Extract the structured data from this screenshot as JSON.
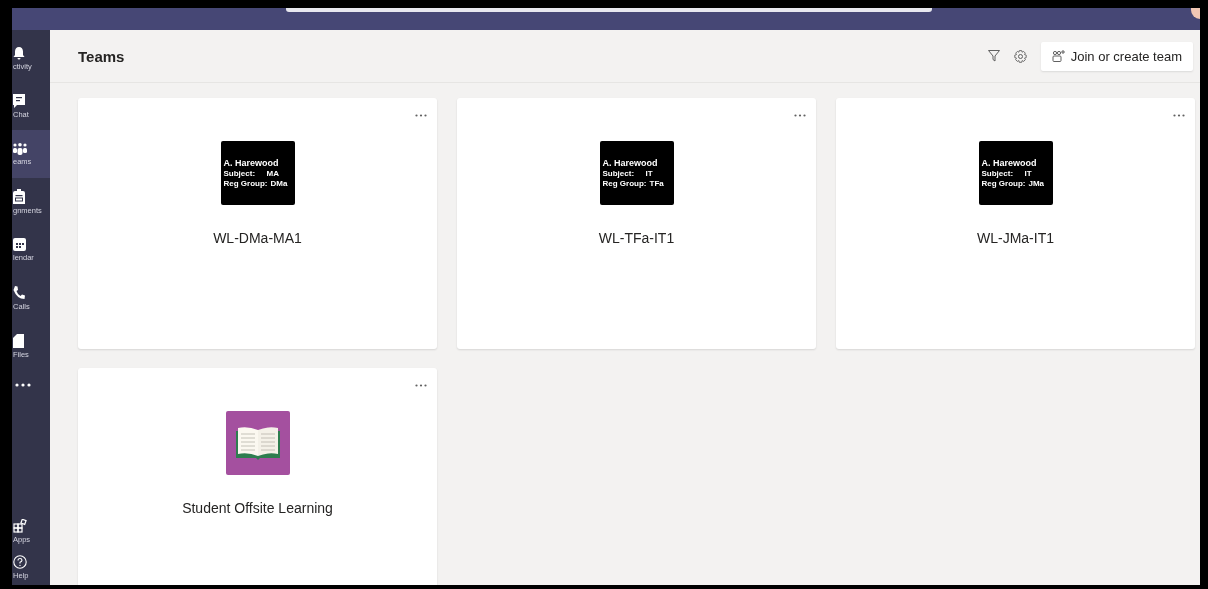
{
  "rail": {
    "items": [
      {
        "kind": "bell",
        "label": "ctivity",
        "selected": false
      },
      {
        "kind": "chat",
        "label": "Chat",
        "selected": false
      },
      {
        "kind": "teams",
        "label": "eams",
        "selected": true
      },
      {
        "kind": "bag",
        "label": "gnments",
        "selected": false
      },
      {
        "kind": "calendar",
        "label": "lendar",
        "selected": false
      },
      {
        "kind": "phone",
        "label": "Calls",
        "selected": false
      },
      {
        "kind": "file",
        "label": "Files",
        "selected": false
      },
      {
        "kind": "more",
        "selected": false
      }
    ],
    "bottom_items": [
      {
        "kind": "apps",
        "label": "Apps",
        "selected": false
      },
      {
        "kind": "help",
        "label": "Help",
        "selected": false
      }
    ]
  },
  "header": {
    "title": "Teams",
    "join_button": "Join or create team"
  },
  "teams": [
    {
      "name": "WL-DMa-MA1",
      "avatar": {
        "kind": "text-tile",
        "owner": "A. Harewood",
        "rows": [
          {
            "label": "Subject:",
            "value": "MA"
          },
          {
            "label": "Reg Group:",
            "value": "DMa"
          }
        ]
      }
    },
    {
      "name": "WL-TFa-IT1",
      "avatar": {
        "kind": "text-tile",
        "owner": "A. Harewood",
        "rows": [
          {
            "label": "Subject:",
            "value": "IT"
          },
          {
            "label": "Reg Group:",
            "value": "TFa"
          }
        ]
      }
    },
    {
      "name": "WL-JMa-IT1",
      "avatar": {
        "kind": "text-tile",
        "owner": "A. Harewood",
        "rows": [
          {
            "label": "Subject:",
            "value": "IT"
          },
          {
            "label": "Reg Group:",
            "value": "JMa"
          }
        ]
      }
    },
    {
      "name": "Student Offsite Learning",
      "avatar": {
        "kind": "book"
      }
    }
  ]
}
